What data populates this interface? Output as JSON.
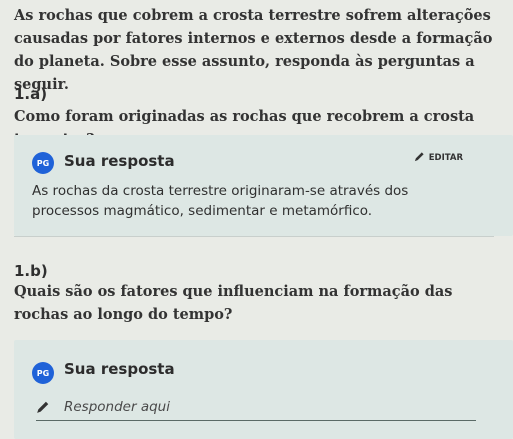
{
  "intro_text": "As rochas que cobrem a crosta terrestre sofrem alterações causadas por fatores internos e externos desde a formação do planeta. Sobre esse assunto, responda às perguntas a seguir.",
  "questions": [
    {
      "number": "1.a)",
      "text": "Como foram originadas as rochas que recobrem a crosta terrestre?",
      "avatar": "PG",
      "response_heading": "Sua resposta",
      "edit_label": "EDITAR",
      "answer": "As rochas da crosta terrestre originaram-se através dos processos magmático, sedimentar e metamórfico."
    },
    {
      "number": "1.b)",
      "text": "Quais são os fatores que influenciam na formação das rochas ao longo do tempo?",
      "avatar": "PG",
      "response_heading": "Sua resposta",
      "placeholder": "Responder aqui"
    }
  ],
  "colors": {
    "background": "#e9ebe6",
    "card": "#dde7e4",
    "avatar": "#1f62d8"
  }
}
